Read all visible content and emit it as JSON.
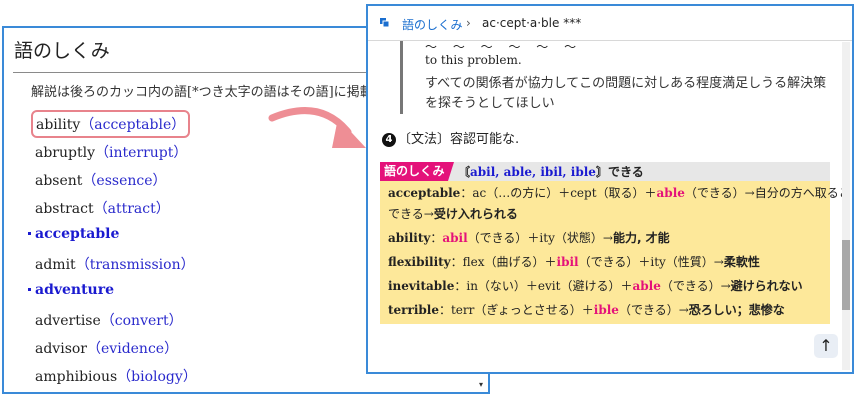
{
  "left_window": {
    "title": "語のしくみ",
    "description": "解説は後ろのカッコ内の語[*つき太字の語はその語]に掲載",
    "entries": [
      {
        "word": "ability",
        "open": "（",
        "ref": "acceptable",
        "close": "）"
      },
      {
        "word": "abruptly",
        "open": "（",
        "ref": "interrupt",
        "close": "）"
      },
      {
        "word": "absent",
        "open": "（",
        "ref": "essence",
        "close": "）"
      },
      {
        "word": "abstract",
        "open": "（",
        "ref": "attract",
        "close": "）"
      },
      {
        "word": "acceptable",
        "open": "",
        "ref": "",
        "close": ""
      },
      {
        "word": "admit",
        "open": "（",
        "ref": "transmission",
        "close": "）"
      },
      {
        "word": "adventure",
        "open": "",
        "ref": "",
        "close": ""
      },
      {
        "word": "advertise",
        "open": "（",
        "ref": "convert",
        "close": "）"
      },
      {
        "word": "advisor",
        "open": "（",
        "ref": "evidence",
        "close": "）"
      },
      {
        "word": "amphibious",
        "open": "（",
        "ref": "biology",
        "close": "）"
      }
    ],
    "scroll_down_glyph": "▾"
  },
  "right_window": {
    "breadcrumb": {
      "home": "語のしくみ",
      "separator": "›",
      "current": "ac·cept·a·ble ***"
    },
    "example_cut": "～ 〜 ～ ～ ～ ～",
    "example_en": "to this problem.",
    "example_ja": "すべての関係者が協力してこの問題に対しある程度満足しうる解決策を探そうとしてほしい",
    "sense_number": "4",
    "sense_text": "〔文法〕容認可能な.",
    "box": {
      "tag": "語のしくみ",
      "head_open": "〘",
      "affixes": "abil, able, ibil, ible",
      "head_close": "〙",
      "head_suffix": "できる",
      "rows": [
        {
          "word": "acceptable",
          "pre": "：ac（…の方に）＋cept（取る）＋",
          "affix": "able",
          "post": "（できる）→自分の方へ取ることが",
          "line2": "できる→",
          "result": "受け入れられる"
        },
        {
          "word": "ability",
          "pre": "：",
          "affix": "abil",
          "post": "（できる）＋ity（状態）→",
          "line2": "",
          "result": "能力, 才能"
        },
        {
          "word": "flexibility",
          "pre": "：flex（曲げる）＋",
          "affix": "ibil",
          "post": "（できる）＋ity（性質）→",
          "line2": "",
          "result": "柔軟性"
        },
        {
          "word": "inevitable",
          "pre": "：in（ない）＋evit（避ける）＋",
          "affix": "able",
          "post": "（できる）→",
          "line2": "",
          "result": "避けられない"
        },
        {
          "word": "terrible",
          "pre": "：terr（ぎょっとさせる）＋",
          "affix": "ible",
          "post": "（できる）→",
          "line2": "",
          "result": "恐ろしい；悲惨な"
        }
      ]
    },
    "scroll_top_glyph": "↑"
  },
  "colors": {
    "window_border": "#3a8ad8",
    "link": "#2a2acc",
    "accent_pink": "#e4127a",
    "box_bg": "#fde89a",
    "highlight_outline": "#e8838c",
    "arrow": "#ee8e95"
  },
  "icons": [
    "copy-pages-icon",
    "curved-arrow-icon",
    "scroll-top-icon"
  ]
}
